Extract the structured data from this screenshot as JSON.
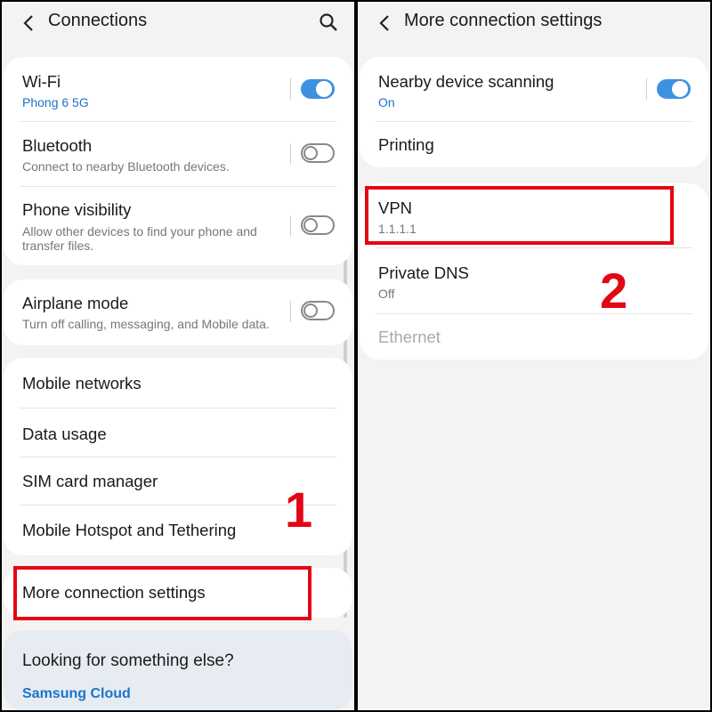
{
  "left": {
    "title": "Connections",
    "wifi": {
      "label": "Wi-Fi",
      "sub": "Phong 6 5G",
      "on": true
    },
    "bluetooth": {
      "label": "Bluetooth",
      "sub": "Connect to nearby Bluetooth devices.",
      "on": false
    },
    "visibility": {
      "label": "Phone visibility",
      "sub1": "Allow other devices to find your phone and",
      "sub2": "transfer files.",
      "on": false
    },
    "airplane": {
      "label": "Airplane mode",
      "sub": "Turn off calling, messaging, and Mobile data.",
      "on": false
    },
    "mobile_networks": "Mobile networks",
    "data_usage": "Data usage",
    "sim_manager": "SIM card manager",
    "hotspot": "Mobile Hotspot and Tethering",
    "more_settings": "More connection settings",
    "looking": "Looking for something else?",
    "samsung_cloud": "Samsung Cloud",
    "step_label": "1"
  },
  "right": {
    "title": "More connection settings",
    "nearby": {
      "label": "Nearby device scanning",
      "sub": "On",
      "on": true
    },
    "printing": "Printing",
    "vpn": {
      "label": "VPN",
      "sub": "1.1.1.1"
    },
    "private_dns": {
      "label": "Private DNS",
      "sub": "Off"
    },
    "ethernet": "Ethernet",
    "step_label": "2"
  },
  "colors": {
    "accent": "#3e91e0",
    "link": "#1b74c9",
    "annotation": "#e30613",
    "background": "#f3f3f3"
  },
  "icons": [
    "back-arrow-icon",
    "search-icon"
  ]
}
